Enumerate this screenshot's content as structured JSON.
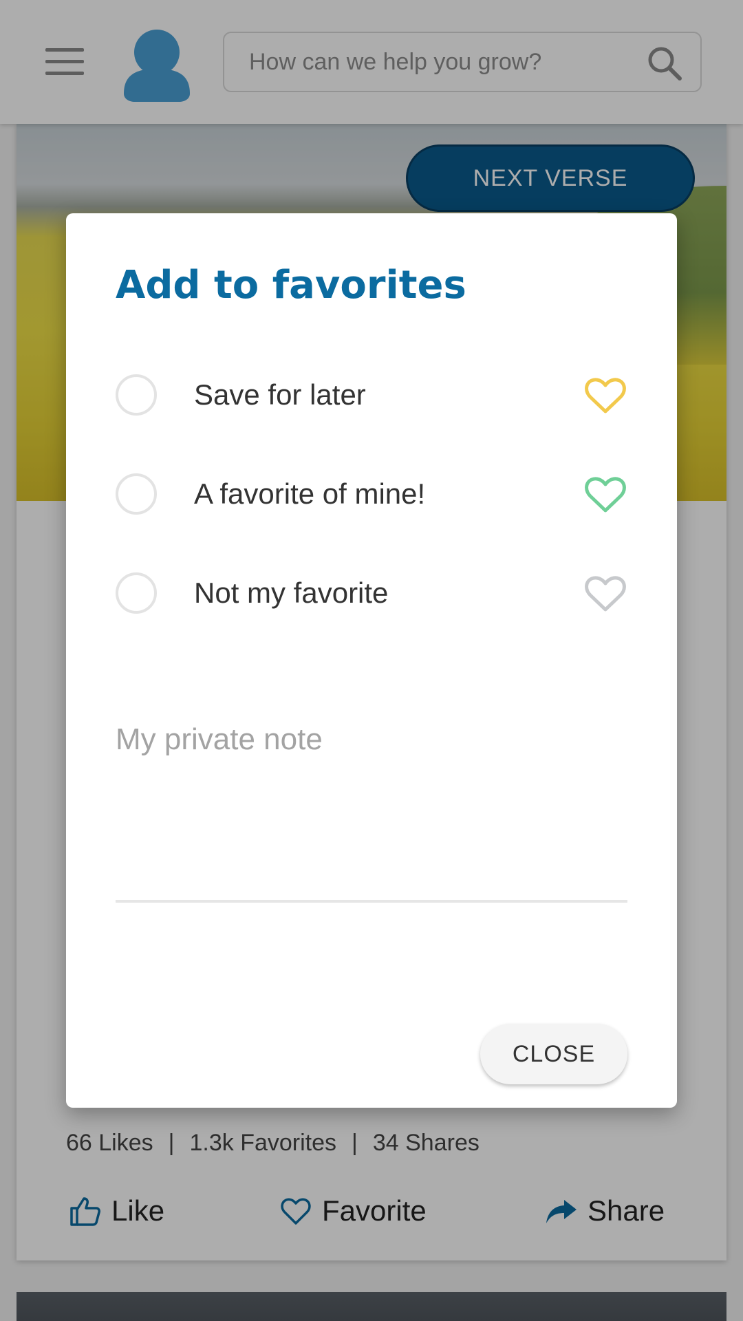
{
  "header": {
    "search_placeholder": "How can we help you grow?"
  },
  "card": {
    "next_button_label": "NEXT VERSE",
    "stats": {
      "likes": "66 Likes",
      "separator": "|",
      "favorites": "1.3k Favorites",
      "shares": "34 Shares"
    },
    "actions": {
      "like": "Like",
      "favorite": "Favorite",
      "share": "Share"
    }
  },
  "modal": {
    "title": "Add to favorites",
    "options": [
      {
        "label": "Save for later",
        "heart_color": "#f2c94c"
      },
      {
        "label": "A favorite of mine!",
        "heart_color": "#6fcf97"
      },
      {
        "label": "Not my favorite",
        "heart_color": "#c7c9cc"
      }
    ],
    "note_placeholder": "My private note",
    "close_label": "CLOSE"
  },
  "colors": {
    "brand_blue": "#0b6ba0",
    "button_dark_blue": "#0a5a8c",
    "avatar_blue": "#4a9fd4"
  }
}
